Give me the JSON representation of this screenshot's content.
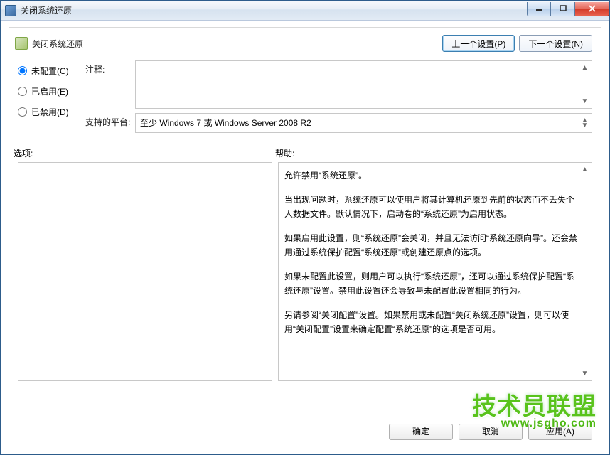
{
  "window": {
    "title": "关闭系统还原"
  },
  "header": {
    "title": "关闭系统还原",
    "prev_button": "上一个设置(P)",
    "next_button": "下一个设置(N)"
  },
  "radios": {
    "not_configured": "未配置(C)",
    "enabled": "已启用(E)",
    "disabled": "已禁用(D)",
    "selected": "not_configured"
  },
  "fields": {
    "comment_label": "注释:",
    "comment_value": "",
    "platform_label": "支持的平台:",
    "platform_value": "至少 Windows 7 或 Windows Server 2008 R2"
  },
  "split": {
    "options_label": "选项:",
    "help_label": "帮助:"
  },
  "help": {
    "p1": "允许禁用“系统还原”。",
    "p2": "当出现问题时，系统还原可以使用户将其计算机还原到先前的状态而不丢失个人数据文件。默认情况下，启动卷的“系统还原”为启用状态。",
    "p3": "如果启用此设置，则“系统还原”会关闭，并且无法访问“系统还原向导”。还会禁用通过系统保护配置“系统还原”或创建还原点的选项。",
    "p4": "如果未配置此设置，则用户可以执行“系统还原”，还可以通过系统保护配置“系统还原”设置。禁用此设置还会导致与未配置此设置相同的行为。",
    "p5": "另请参阅“关闭配置”设置。如果禁用或未配置“关闭系统还原”设置，则可以使用“关闭配置”设置来确定配置“系统还原”的选项是否可用。"
  },
  "buttons": {
    "ok": "确定",
    "cancel": "取消",
    "apply": "应用(A)"
  },
  "watermark": {
    "text": "技术员联盟",
    "url": "www.jsgho.com"
  }
}
